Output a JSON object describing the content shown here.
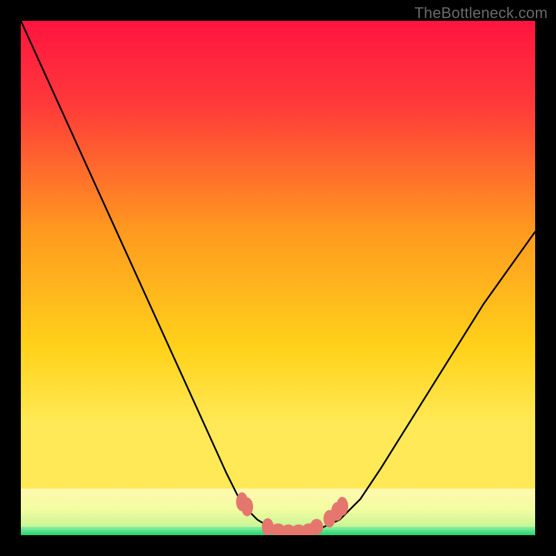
{
  "watermark": "TheBottleneck.com",
  "chart_data": {
    "type": "line",
    "title": "",
    "xlabel": "",
    "ylabel": "",
    "xlim": [
      0,
      100
    ],
    "ylim": [
      0,
      100
    ],
    "grid": false,
    "legend": false,
    "series": [
      {
        "name": "curve",
        "color": "#000000",
        "x": [
          0,
          5,
          10,
          15,
          20,
          25,
          30,
          35,
          40,
          43,
          46,
          49,
          52,
          55,
          58,
          62,
          66,
          70,
          75,
          80,
          85,
          90,
          95,
          100
        ],
        "values": [
          100,
          89,
          78,
          67,
          56,
          45,
          34,
          23,
          12,
          6,
          3,
          1.2,
          0.6,
          0.6,
          1.2,
          3,
          7,
          13,
          21,
          29,
          37,
          45,
          52,
          59
        ]
      },
      {
        "name": "highlight-dots",
        "color": "#e5766d",
        "x": [
          43,
          44,
          48,
          50,
          52,
          54,
          56,
          57.5,
          60,
          61.5,
          62.5
        ],
        "values": [
          6.5,
          5.5,
          1.6,
          1.0,
          0.8,
          0.8,
          1.0,
          1.6,
          3.2,
          4.6,
          5.6
        ]
      }
    ],
    "bands": [
      {
        "name": "green-base",
        "y0": 0,
        "y1": 1.6,
        "fill": "#26e07b"
      },
      {
        "name": "pale-band",
        "y0": 1.6,
        "y1": 9,
        "fill": "#f6fca1"
      }
    ],
    "gradient": {
      "top": "#ff1a3f",
      "mid": "#ffc21a",
      "bottom": "#ffe956"
    }
  }
}
